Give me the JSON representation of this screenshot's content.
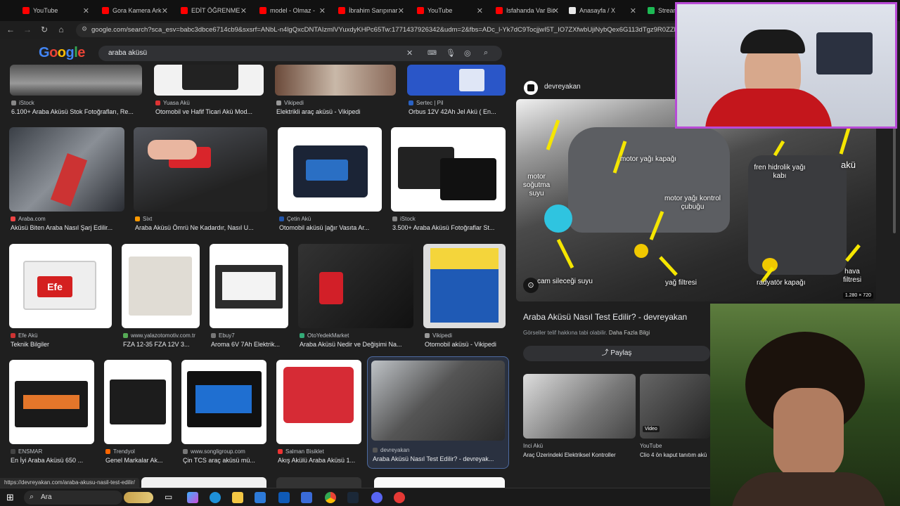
{
  "tabs": [
    {
      "label": "YouTube",
      "color": "#ff0000"
    },
    {
      "label": "Gora Kamera Arka",
      "color": "#ff0000"
    },
    {
      "label": "EDİT ÖĞRENMEY",
      "color": "#ff0000"
    },
    {
      "label": "model - Olmaz -",
      "color": "#ff0000"
    },
    {
      "label": "İbrahim Sarıpınar",
      "color": "#ff0000"
    },
    {
      "label": "YouTube",
      "color": "#ff0000"
    },
    {
      "label": "Isfahanda Var Bir",
      "color": "#ff0000"
    },
    {
      "label": "Anasayfa / X",
      "color": "#e8e8e8"
    },
    {
      "label": "Stream",
      "color": "#1db954"
    }
  ],
  "address_bar": {
    "url": "google.com/search?sca_esv=babc3dbce6714cb9&sxsrf=ANbL-n4lgQxcDNTAIzmlVYuxdyKHPc65Tw:1771437926342&udm=2&fbs=ADc_l-Yk7dC9TocjjwI5T_IO7ZXfwbUjiNybQex6G113dTgz9R0ZZlPAVcVOd"
  },
  "search": {
    "logo": "Google",
    "query": "araba aküsü"
  },
  "results": [
    {
      "source": "iStock",
      "title": "6.100+ Araba Aküsü Stok Fotoğrafları, Re...",
      "fav": "#888"
    },
    {
      "source": "Yuasa Akü",
      "title": "Otomobil ve Hafif Ticari Akü Mod...",
      "fav": "#d33"
    },
    {
      "source": "Vikipedi",
      "title": "Elektrikli araç aküsü - Vikipedi",
      "fav": "#999"
    },
    {
      "source": "Sertec | Pil",
      "title": "Orbus 12V 42Ah Jel Akü ( En...",
      "fav": "#2a62c4"
    },
    {
      "source": "Araba.com",
      "title": "Aküsü Biten Araba Nasıl Şarj Edilir...",
      "fav": "#e44"
    },
    {
      "source": "Sixt",
      "title": "Araba Aküsü Ömrü Ne Kadardır, Nasıl U...",
      "fav": "#f90"
    },
    {
      "source": "Çetin Akü",
      "title": "Otomobil aküsü |ağır Vasıta Ar...",
      "fav": "#2255aa"
    },
    {
      "source": "iStock",
      "title": "3.500+ Araba Aküsü Fotoğraflar St...",
      "fav": "#888"
    },
    {
      "source": "Efe Akü",
      "title": "Teknik Bilgiler",
      "fav": "#c33"
    },
    {
      "source": "www.yalazotomotiv.com.tr",
      "title": "FZA 12-35 FZA 12V 3...",
      "fav": "#5a5"
    },
    {
      "source": "Ebuy7",
      "title": "Aroma 6V 7Ah Elektrik...",
      "fav": "#777"
    },
    {
      "source": "OtoYedekMarket",
      "title": "Araba Aküsü Nedir ve Değişimi Na...",
      "fav": "#3a7"
    },
    {
      "source": "Vikipedi",
      "title": "Otomobil aküsü - Vikipedi",
      "fav": "#999"
    },
    {
      "source": "ENSMAR",
      "title": "En İyi Araba Aküsü 650 ...",
      "fav": "#444"
    },
    {
      "source": "Trendyol",
      "title": "Genel Markalar Ak...",
      "fav": "#f60"
    },
    {
      "source": "www.songligroup.com",
      "title": "Çin TCS araç aküsü mü...",
      "fav": "#777"
    },
    {
      "source": "Salman Bisiklet",
      "title": "Akış Akülü Araba Aküsü 1...",
      "fav": "#e33"
    },
    {
      "source": "devreyakan",
      "title": "Araba Aküsü Nasıl Test Edilir? - devreyak...",
      "fav": "#555"
    }
  ],
  "panel": {
    "site": "devreyakan",
    "labels": [
      "motor soğutma suyu",
      "motor yağı kapağı",
      "fren hidrolik yağı kabı",
      "akü",
      "motor yağı kontrol çubuğu",
      "cam sileceği suyu",
      "yağ filtresi",
      "radyatör kapağı",
      "hava filtresi"
    ],
    "dims": "1.280 × 720",
    "title": "Araba Aküsü Nasıl Test Edilir? - devreyakan",
    "notice": "Görseller telif hakkına tabi olabilir.",
    "more": "Daha Fazla Bilgi",
    "share": "Paylaş",
    "related": [
      {
        "source": "Inci Akü",
        "title": "Araç Üzerindeki Elektriksel Kontroller"
      },
      {
        "source": "YouTube",
        "title": "Clio 4 ön kaput tanıtım akü"
      }
    ],
    "video_badge": "Video"
  },
  "status_url": "https://devreyakan.com/araba-akusu-nasil-test-edilir/",
  "taskbar": {
    "search": "Ara"
  }
}
